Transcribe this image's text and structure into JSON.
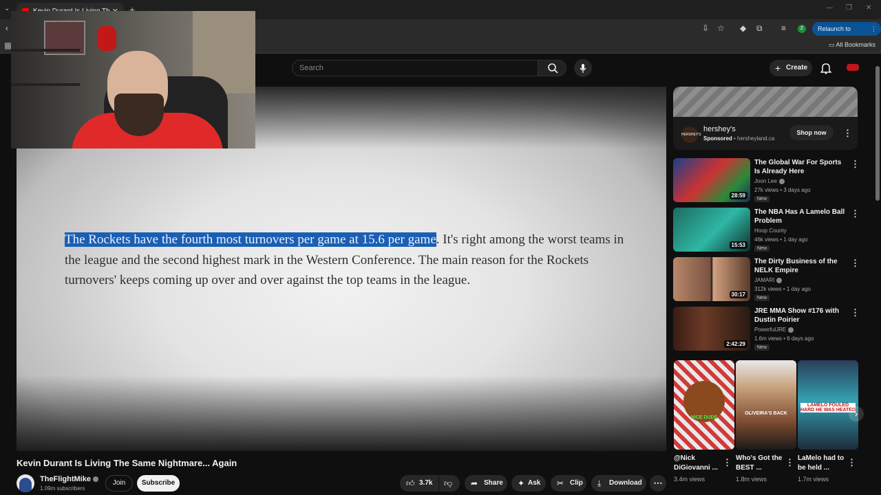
{
  "browser": {
    "tab_title": "Kevin Durant Is Living The Same Nightmare...",
    "new_tab": "+",
    "relaunch": "Relaunch to update",
    "profile_letter": "Z",
    "bookmarks_all": "All Bookmarks"
  },
  "header": {
    "search_placeholder": "Search",
    "create_label": "Create"
  },
  "video": {
    "article_highlight": "The Rockets have the fourth most turnovers per game at 15.6 per game",
    "article_rest": ". It's right among the worst teams in the league and the second highest mark in the Western Conference. The main reason for the Rockets turnovers' keeps coming up over and over against the top teams in the league.",
    "title": "Kevin Durant Is Living The Same Nightmare... Again"
  },
  "channel": {
    "name": "TheFlightMike",
    "subscribers": "1.09m subscribers",
    "join_label": "Join",
    "subscribe_label": "Subscribe"
  },
  "actions": {
    "likes": "3.7k",
    "share": "Share",
    "ask": "Ask",
    "clip": "Clip",
    "download": "Download"
  },
  "ad": {
    "logo_text": "HERSHEY'S",
    "name": "hershey's",
    "sponsored": "Sponsored",
    "domain": "hersheyland.ca",
    "cta": "Shop now"
  },
  "recommendations": [
    {
      "title": "The Global War For Sports Is Already Here",
      "channel": "Joon Lee",
      "meta": "27k views • 3 days ago",
      "badge": "New",
      "duration": "28:59"
    },
    {
      "title": "The NBA Has A Lamelo Ball Problem",
      "channel": "Hoop County",
      "meta": "46k views • 1 day ago",
      "badge": "New",
      "duration": "15:53"
    },
    {
      "title": "The Dirty Business of the NELK Empire",
      "channel": "JAMARI",
      "meta": "312k views • 1 day ago",
      "badge": "New",
      "duration": "30:17"
    },
    {
      "title": "JRE MMA Show #176 with Dustin Poirier",
      "channel": "PowerfulJRE",
      "meta": "1.6m views • 6 days ago",
      "badge": "New",
      "duration": "2:42:29"
    }
  ],
  "shorts": [
    {
      "title": "@Nick DiGiovanni ...",
      "views": "3.4m views",
      "caption": "NICE DUDE"
    },
    {
      "title": "Who's Got the BEST ...",
      "views": "1.8m views",
      "caption": "OLIVEIRA'S BACK"
    },
    {
      "title": "LaMelo had to be held ...",
      "views": "1.7m views",
      "caption": "LAMELO FOULED HARD HE WAS HEATED"
    }
  ],
  "colors": {
    "highlight": "#1a5fb4",
    "subscribe_bg": "#f1f1f1",
    "page_bg": "#0f0f0f"
  }
}
